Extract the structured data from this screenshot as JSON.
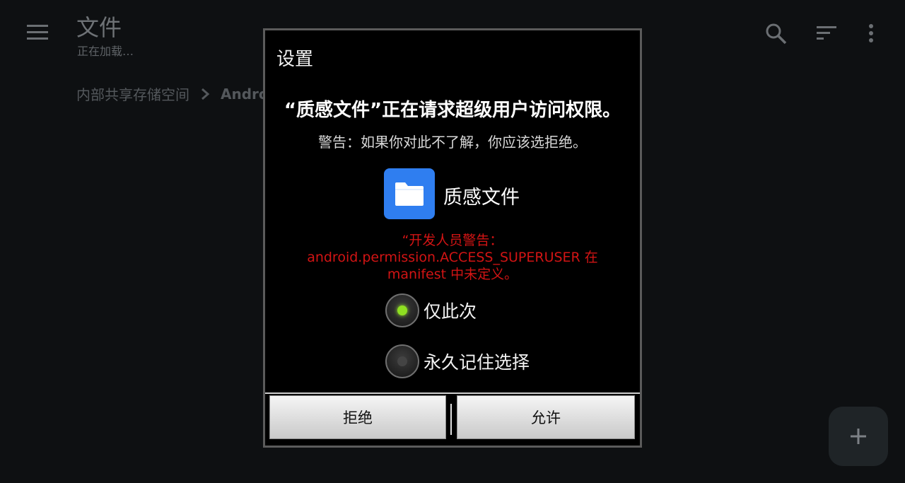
{
  "toolbar": {
    "title": "文件",
    "subtitle": "正在加载…",
    "icons": [
      "menu-icon",
      "search-icon",
      "sort-icon",
      "more-vert-icon"
    ]
  },
  "breadcrumb": {
    "root": "内部共享存储空间",
    "current": "Android"
  },
  "fab": {
    "icon": "plus-icon"
  },
  "dialog": {
    "title": "设置",
    "request": "“质感文件”正在请求超级用户访问权限。",
    "warning": "警告：如果你对此不了解，你应该选拒绝。",
    "app_name": "质感文件",
    "app_icon": "folder-icon",
    "dev_warning_lines": [
      "“开发人员警告：",
      "android.permission.ACCESS_SUPERUSER 在",
      "manifest 中未定义。"
    ],
    "options": [
      {
        "label": "仅此次",
        "selected": true
      },
      {
        "label": "永久记住选择",
        "selected": false
      }
    ],
    "deny_label": "拒绝",
    "allow_label": "允许"
  },
  "colors": {
    "background": "#0e1012",
    "dialog_bg": "#000000",
    "warning_red": "#d21414",
    "app_icon_blue": "#2f7ef0",
    "radio_on": "#8fe021"
  }
}
